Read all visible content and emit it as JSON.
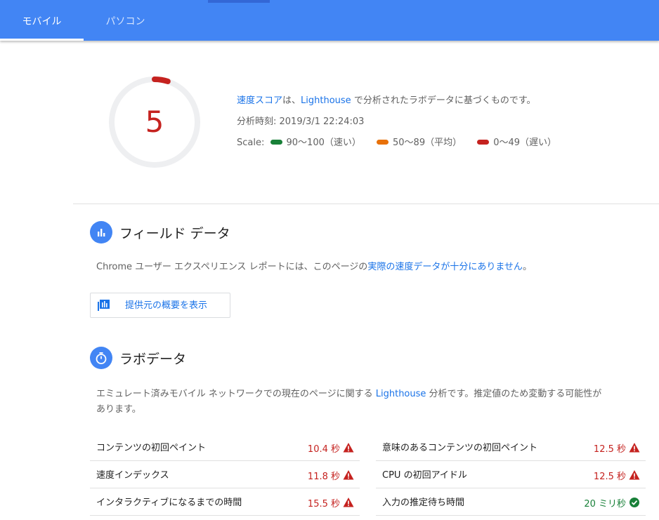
{
  "tabs": [
    {
      "label": "モバイル",
      "active": true
    },
    {
      "label": "パソコン",
      "active": false
    }
  ],
  "score": {
    "value": "5",
    "fraction": 0.05,
    "color": "#c5221f"
  },
  "summary": {
    "line1_link": "速度スコア",
    "line1_mid": "は、",
    "line1_link2": "Lighthouse",
    "line1_tail": " で分析されたラボデータに基づくものです。",
    "timestamp_label": "分析時刻: ",
    "timestamp": "2019/3/1 22:24:03",
    "scale_label": "Scale:",
    "scale": [
      {
        "label": "90〜100（速い）",
        "color": "#188038"
      },
      {
        "label": "50〜89（平均）",
        "color": "#e8710a"
      },
      {
        "label": "0〜49（遅い）",
        "color": "#c5221f"
      }
    ]
  },
  "field": {
    "title": "フィールド データ",
    "icon": "bar-chart-icon",
    "text_prefix": "Chrome ユーザー エクスペリエンス レポートには、このページの",
    "text_link": "実際の速度データが十分にありません",
    "text_suffix": "。",
    "button_label": "提供元の概要を表示",
    "button_icon": "origin-summary-icon"
  },
  "lab": {
    "title": "ラボデータ",
    "icon": "stopwatch-icon",
    "text_prefix": "エミュレート済みモバイル ネットワークでの現在のページに関する ",
    "text_link": "Lighthouse",
    "text_suffix": " 分析です。推定値のため変動する可能性が",
    "text_line2": "あります。",
    "metrics_left": [
      {
        "label": "コンテンツの初回ペイント",
        "value": "10.4 秒",
        "status": "slow"
      },
      {
        "label": "速度インデックス",
        "value": "11.8 秒",
        "status": "slow"
      },
      {
        "label": "インタラクティブになるまでの時間",
        "value": "15.5 秒",
        "status": "slow"
      }
    ],
    "metrics_right": [
      {
        "label": "意味のあるコンテンツの初回ペイント",
        "value": "12.5 秒",
        "status": "slow"
      },
      {
        "label": "CPU の初回アイドル",
        "value": "12.5 秒",
        "status": "slow"
      },
      {
        "label": "入力の推定待ち時間",
        "value": "20 ミリ秒",
        "status": "fast"
      }
    ]
  }
}
